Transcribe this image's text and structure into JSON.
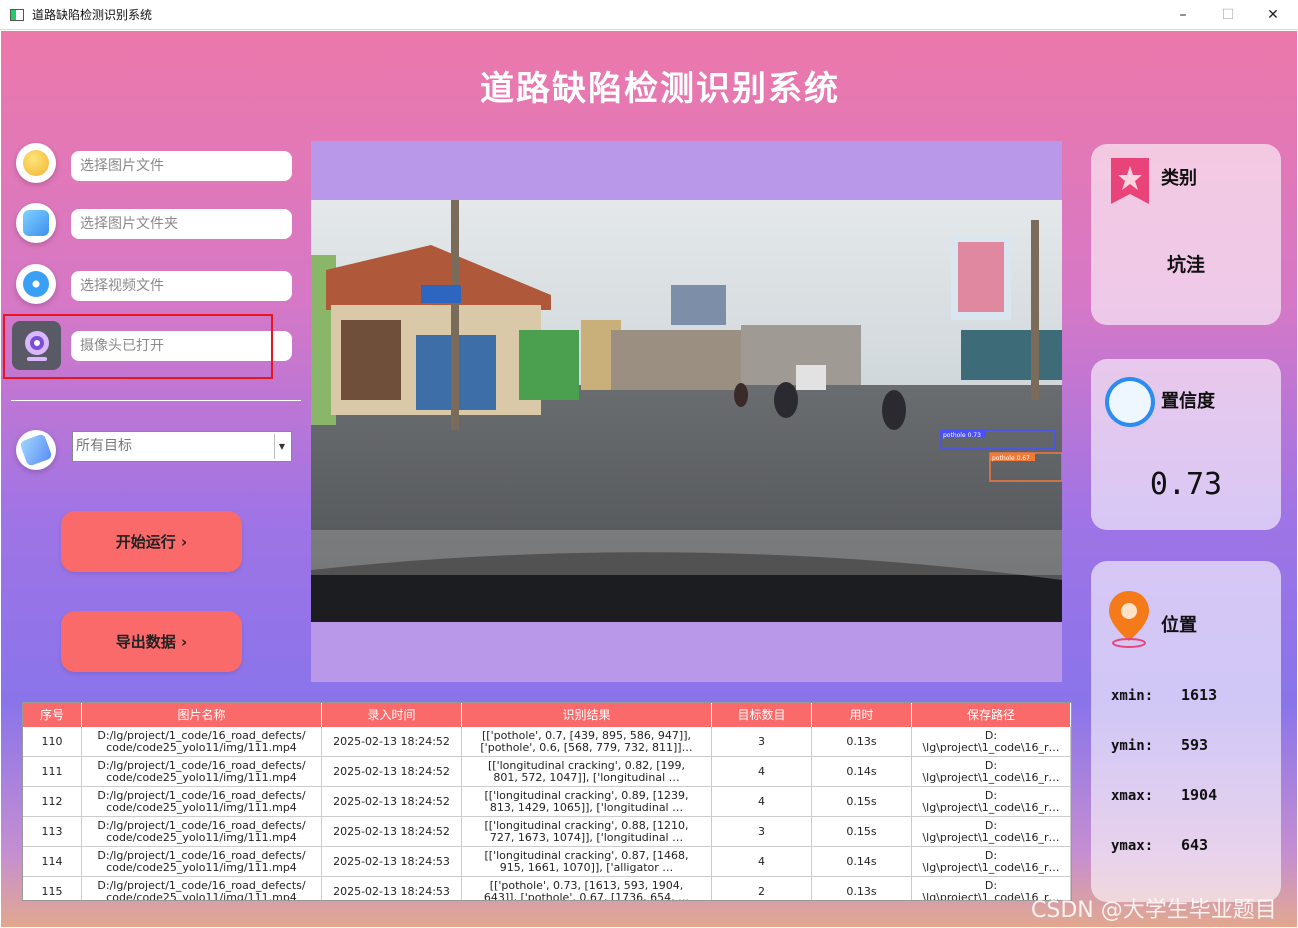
{
  "window": {
    "title": "道路缺陷检测识别系统",
    "minimize": "–",
    "maximize": "☐",
    "close": "✕"
  },
  "app_title": "道路缺陷检测识别系统",
  "sidebar": {
    "image_file_placeholder": "选择图片文件",
    "image_folder_placeholder": "选择图片文件夹",
    "video_file_placeholder": "选择视频文件",
    "camera_status": "摄像头已打开",
    "target_select": "所有目标",
    "start_button": "开始运行 ›",
    "export_button": "导出数据 ›"
  },
  "detections": [
    {
      "label": "pothole 0.73"
    },
    {
      "label": "pothole 0.67"
    }
  ],
  "cards": {
    "category": {
      "label": "类别",
      "value": "坑洼"
    },
    "confidence": {
      "label": "置信度",
      "value": "0.73"
    },
    "position": {
      "label": "位置",
      "xmin_label": "xmin:",
      "xmin": "1613",
      "ymin_label": "ymin:",
      "ymin": "593",
      "xmax_label": "xmax:",
      "xmax": "1904",
      "ymax_label": "ymax:",
      "ymax": "643"
    }
  },
  "table": {
    "headers": [
      "序号",
      "图片名称",
      "录入时间",
      "识别结果",
      "目标数目",
      "用时",
      "保存路径"
    ],
    "rows": [
      [
        "110",
        "D:/lg/project/1_code/16_road_defects/\ncode/code25_yolo11/img/111.mp4",
        "2025-02-13 18:24:52",
        "[['pothole', 0.7, [439, 895, 586, 947]],\n['pothole', 0.6, [568, 779, 732, 811]]…",
        "3",
        "0.13s",
        "D:\n\\lg\\project\\1_code\\16_r…"
      ],
      [
        "111",
        "D:/lg/project/1_code/16_road_defects/\ncode/code25_yolo11/img/111.mp4",
        "2025-02-13 18:24:52",
        "[['longitudinal cracking', 0.82, [199,\n801, 572, 1047]], ['longitudinal …",
        "4",
        "0.14s",
        "D:\n\\lg\\project\\1_code\\16_r…"
      ],
      [
        "112",
        "D:/lg/project/1_code/16_road_defects/\ncode/code25_yolo11/img/111.mp4",
        "2025-02-13 18:24:52",
        "[['longitudinal cracking', 0.89, [1239,\n813, 1429, 1065]], ['longitudinal …",
        "4",
        "0.15s",
        "D:\n\\lg\\project\\1_code\\16_r…"
      ],
      [
        "113",
        "D:/lg/project/1_code/16_road_defects/\ncode/code25_yolo11/img/111.mp4",
        "2025-02-13 18:24:52",
        "[['longitudinal cracking', 0.88, [1210,\n727, 1673, 1074]], ['longitudinal …",
        "3",
        "0.15s",
        "D:\n\\lg\\project\\1_code\\16_r…"
      ],
      [
        "114",
        "D:/lg/project/1_code/16_road_defects/\ncode/code25_yolo11/img/111.mp4",
        "2025-02-13 18:24:53",
        "[['longitudinal cracking', 0.87, [1468,\n915, 1661, 1070]], ['alligator …",
        "4",
        "0.14s",
        "D:\n\\lg\\project\\1_code\\16_r…"
      ],
      [
        "115",
        "D:/lg/project/1_code/16_road_defects/\ncode/code25_yolo11/img/111.mp4",
        "2025-02-13 18:24:53",
        "[['pothole', 0.73, [1613, 593, 1904,\n643]], ['pothole', 0.67, [1736, 654, …",
        "2",
        "0.13s",
        "D:\n\\lg\\project\\1_code\\16_r…"
      ]
    ]
  },
  "watermark": "CSDN @大学生毕业题目",
  "colors": {
    "accent": "#fb6a6a",
    "panel": "#b998ea",
    "highlight": "#e8161e"
  }
}
